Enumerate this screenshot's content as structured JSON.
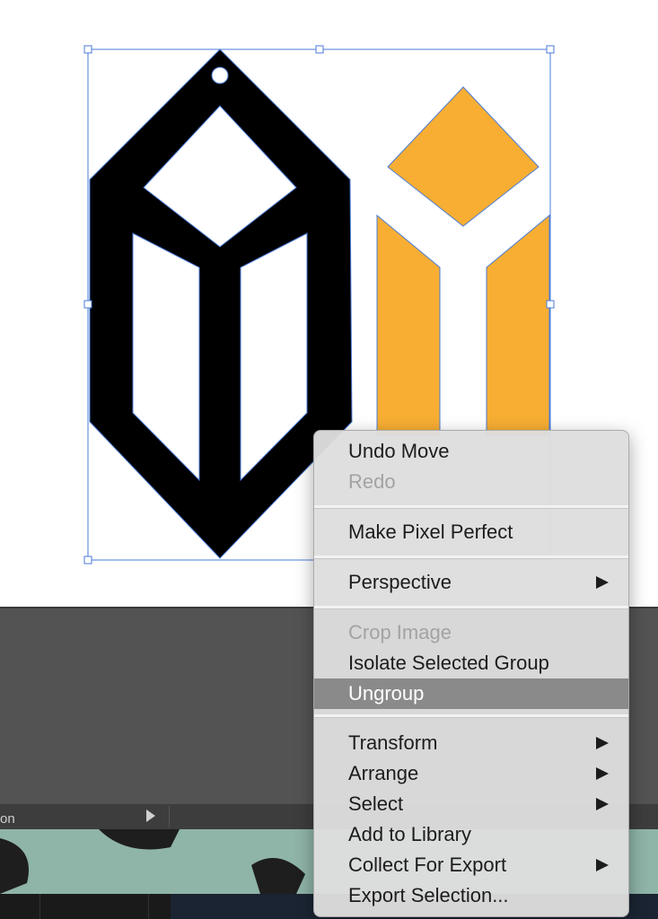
{
  "colors": {
    "selection": "#4a7bd8",
    "orange_fill": "#f7ae33",
    "black_fill": "#000000",
    "panel": "#535353",
    "menu_highlight": "#8a8a8a"
  },
  "panel": {
    "strip_label": "on"
  },
  "menu": {
    "undo_move": "Undo Move",
    "redo": "Redo",
    "make_pixel_perfect": "Make Pixel Perfect",
    "perspective": "Perspective",
    "crop_image": "Crop Image",
    "isolate_selected_group": "Isolate Selected Group",
    "ungroup": "Ungroup",
    "transform": "Transform",
    "arrange": "Arrange",
    "select": "Select",
    "add_to_library": "Add to Library",
    "collect_for_export": "Collect For Export",
    "export_selection": "Export Selection..."
  }
}
